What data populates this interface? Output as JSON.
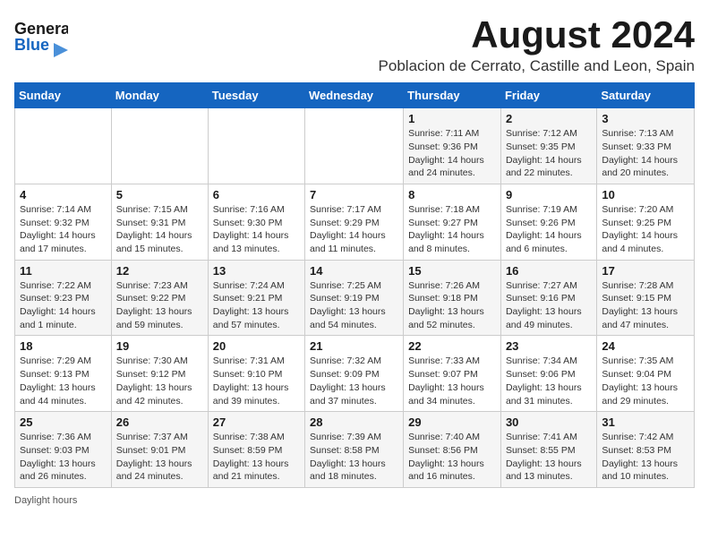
{
  "header": {
    "logo_general": "General",
    "logo_blue": "Blue",
    "month_title": "August 2024",
    "location": "Poblacion de Cerrato, Castille and Leon, Spain"
  },
  "weekdays": [
    "Sunday",
    "Monday",
    "Tuesday",
    "Wednesday",
    "Thursday",
    "Friday",
    "Saturday"
  ],
  "weeks": [
    [
      {
        "day": "",
        "sunrise": "",
        "sunset": "",
        "daylight": ""
      },
      {
        "day": "",
        "sunrise": "",
        "sunset": "",
        "daylight": ""
      },
      {
        "day": "",
        "sunrise": "",
        "sunset": "",
        "daylight": ""
      },
      {
        "day": "",
        "sunrise": "",
        "sunset": "",
        "daylight": ""
      },
      {
        "day": "1",
        "sunrise": "Sunrise: 7:11 AM",
        "sunset": "Sunset: 9:36 PM",
        "daylight": "Daylight: 14 hours and 24 minutes."
      },
      {
        "day": "2",
        "sunrise": "Sunrise: 7:12 AM",
        "sunset": "Sunset: 9:35 PM",
        "daylight": "Daylight: 14 hours and 22 minutes."
      },
      {
        "day": "3",
        "sunrise": "Sunrise: 7:13 AM",
        "sunset": "Sunset: 9:33 PM",
        "daylight": "Daylight: 14 hours and 20 minutes."
      }
    ],
    [
      {
        "day": "4",
        "sunrise": "Sunrise: 7:14 AM",
        "sunset": "Sunset: 9:32 PM",
        "daylight": "Daylight: 14 hours and 17 minutes."
      },
      {
        "day": "5",
        "sunrise": "Sunrise: 7:15 AM",
        "sunset": "Sunset: 9:31 PM",
        "daylight": "Daylight: 14 hours and 15 minutes."
      },
      {
        "day": "6",
        "sunrise": "Sunrise: 7:16 AM",
        "sunset": "Sunset: 9:30 PM",
        "daylight": "Daylight: 14 hours and 13 minutes."
      },
      {
        "day": "7",
        "sunrise": "Sunrise: 7:17 AM",
        "sunset": "Sunset: 9:29 PM",
        "daylight": "Daylight: 14 hours and 11 minutes."
      },
      {
        "day": "8",
        "sunrise": "Sunrise: 7:18 AM",
        "sunset": "Sunset: 9:27 PM",
        "daylight": "Daylight: 14 hours and 8 minutes."
      },
      {
        "day": "9",
        "sunrise": "Sunrise: 7:19 AM",
        "sunset": "Sunset: 9:26 PM",
        "daylight": "Daylight: 14 hours and 6 minutes."
      },
      {
        "day": "10",
        "sunrise": "Sunrise: 7:20 AM",
        "sunset": "Sunset: 9:25 PM",
        "daylight": "Daylight: 14 hours and 4 minutes."
      }
    ],
    [
      {
        "day": "11",
        "sunrise": "Sunrise: 7:22 AM",
        "sunset": "Sunset: 9:23 PM",
        "daylight": "Daylight: 14 hours and 1 minute."
      },
      {
        "day": "12",
        "sunrise": "Sunrise: 7:23 AM",
        "sunset": "Sunset: 9:22 PM",
        "daylight": "Daylight: 13 hours and 59 minutes."
      },
      {
        "day": "13",
        "sunrise": "Sunrise: 7:24 AM",
        "sunset": "Sunset: 9:21 PM",
        "daylight": "Daylight: 13 hours and 57 minutes."
      },
      {
        "day": "14",
        "sunrise": "Sunrise: 7:25 AM",
        "sunset": "Sunset: 9:19 PM",
        "daylight": "Daylight: 13 hours and 54 minutes."
      },
      {
        "day": "15",
        "sunrise": "Sunrise: 7:26 AM",
        "sunset": "Sunset: 9:18 PM",
        "daylight": "Daylight: 13 hours and 52 minutes."
      },
      {
        "day": "16",
        "sunrise": "Sunrise: 7:27 AM",
        "sunset": "Sunset: 9:16 PM",
        "daylight": "Daylight: 13 hours and 49 minutes."
      },
      {
        "day": "17",
        "sunrise": "Sunrise: 7:28 AM",
        "sunset": "Sunset: 9:15 PM",
        "daylight": "Daylight: 13 hours and 47 minutes."
      }
    ],
    [
      {
        "day": "18",
        "sunrise": "Sunrise: 7:29 AM",
        "sunset": "Sunset: 9:13 PM",
        "daylight": "Daylight: 13 hours and 44 minutes."
      },
      {
        "day": "19",
        "sunrise": "Sunrise: 7:30 AM",
        "sunset": "Sunset: 9:12 PM",
        "daylight": "Daylight: 13 hours and 42 minutes."
      },
      {
        "day": "20",
        "sunrise": "Sunrise: 7:31 AM",
        "sunset": "Sunset: 9:10 PM",
        "daylight": "Daylight: 13 hours and 39 minutes."
      },
      {
        "day": "21",
        "sunrise": "Sunrise: 7:32 AM",
        "sunset": "Sunset: 9:09 PM",
        "daylight": "Daylight: 13 hours and 37 minutes."
      },
      {
        "day": "22",
        "sunrise": "Sunrise: 7:33 AM",
        "sunset": "Sunset: 9:07 PM",
        "daylight": "Daylight: 13 hours and 34 minutes."
      },
      {
        "day": "23",
        "sunrise": "Sunrise: 7:34 AM",
        "sunset": "Sunset: 9:06 PM",
        "daylight": "Daylight: 13 hours and 31 minutes."
      },
      {
        "day": "24",
        "sunrise": "Sunrise: 7:35 AM",
        "sunset": "Sunset: 9:04 PM",
        "daylight": "Daylight: 13 hours and 29 minutes."
      }
    ],
    [
      {
        "day": "25",
        "sunrise": "Sunrise: 7:36 AM",
        "sunset": "Sunset: 9:03 PM",
        "daylight": "Daylight: 13 hours and 26 minutes."
      },
      {
        "day": "26",
        "sunrise": "Sunrise: 7:37 AM",
        "sunset": "Sunset: 9:01 PM",
        "daylight": "Daylight: 13 hours and 24 minutes."
      },
      {
        "day": "27",
        "sunrise": "Sunrise: 7:38 AM",
        "sunset": "Sunset: 8:59 PM",
        "daylight": "Daylight: 13 hours and 21 minutes."
      },
      {
        "day": "28",
        "sunrise": "Sunrise: 7:39 AM",
        "sunset": "Sunset: 8:58 PM",
        "daylight": "Daylight: 13 hours and 18 minutes."
      },
      {
        "day": "29",
        "sunrise": "Sunrise: 7:40 AM",
        "sunset": "Sunset: 8:56 PM",
        "daylight": "Daylight: 13 hours and 16 minutes."
      },
      {
        "day": "30",
        "sunrise": "Sunrise: 7:41 AM",
        "sunset": "Sunset: 8:55 PM",
        "daylight": "Daylight: 13 hours and 13 minutes."
      },
      {
        "day": "31",
        "sunrise": "Sunrise: 7:42 AM",
        "sunset": "Sunset: 8:53 PM",
        "daylight": "Daylight: 13 hours and 10 minutes."
      }
    ]
  ],
  "footer": {
    "daylight_label": "Daylight hours"
  }
}
